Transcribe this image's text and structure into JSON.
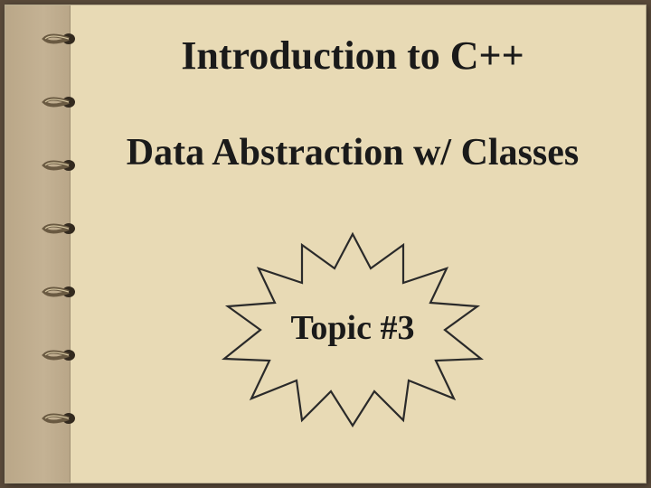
{
  "slide": {
    "title": "Introduction to C++",
    "subtitle": "Data Abstraction w/ Classes",
    "topic_label": "Topic #3"
  },
  "colors": {
    "paper": "#e8dab5",
    "binding": "#baa788",
    "burst_stroke": "#2a2a2a"
  }
}
